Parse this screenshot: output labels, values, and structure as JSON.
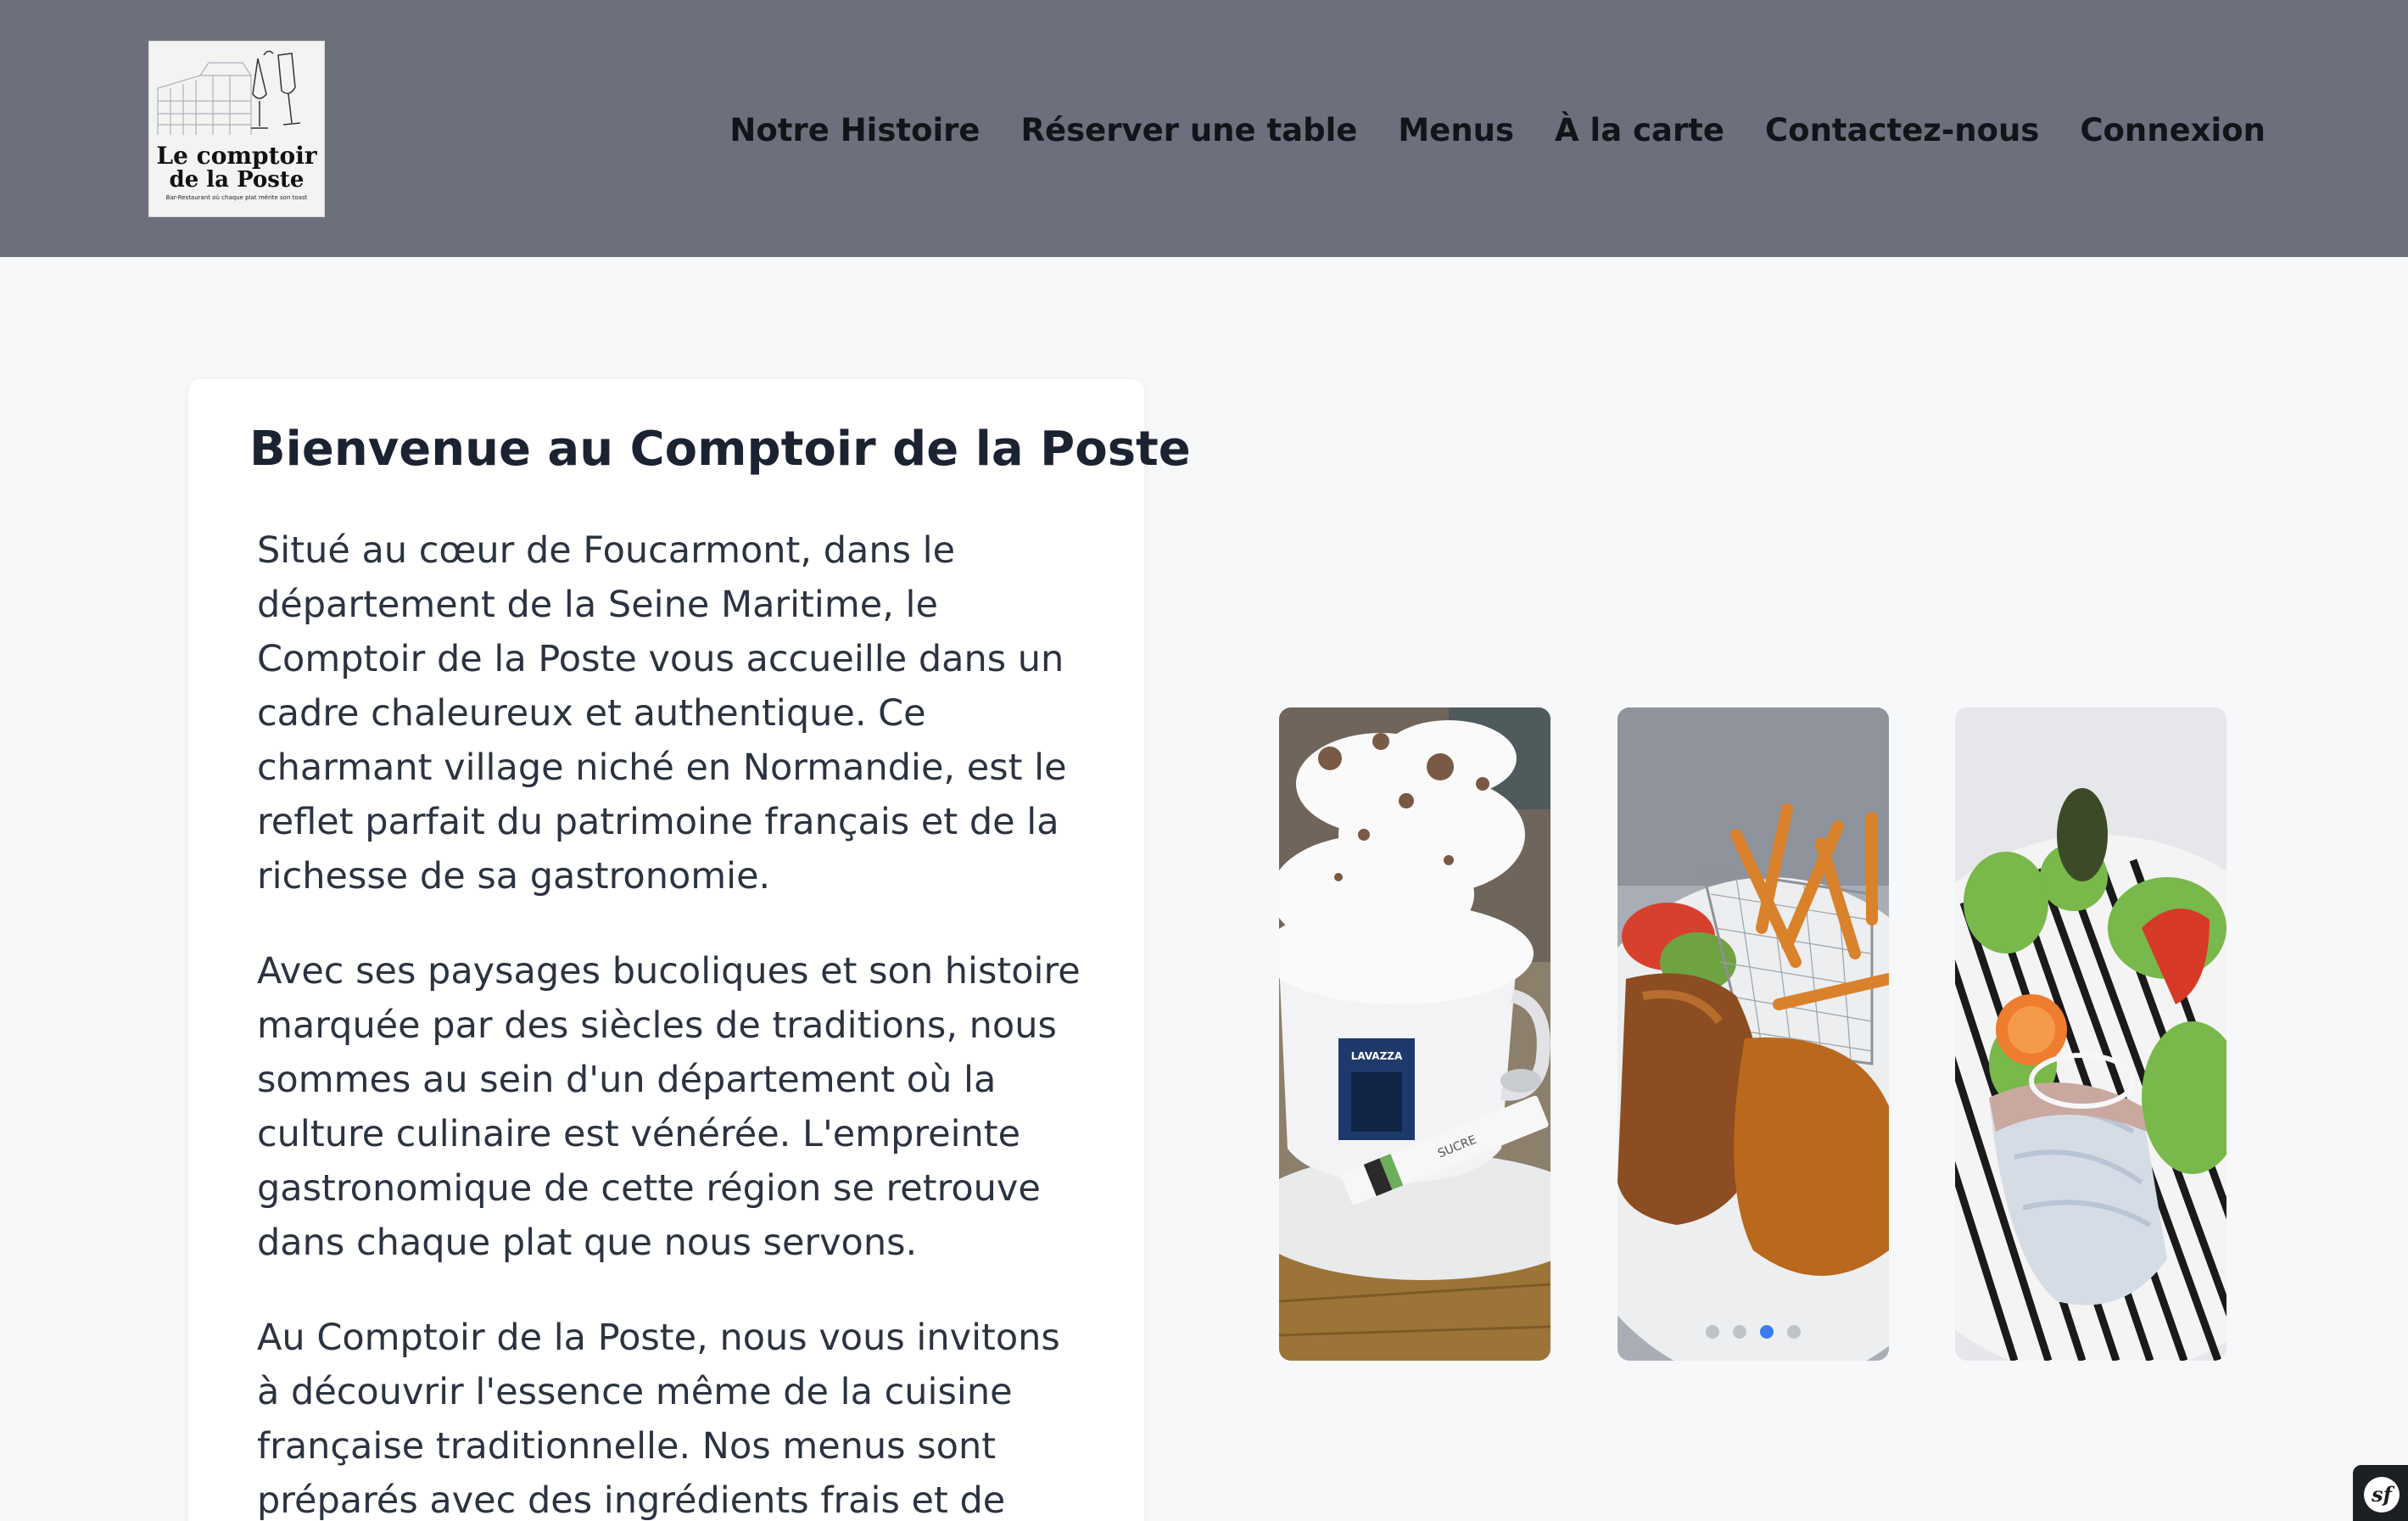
{
  "header": {
    "logo": {
      "line1": "Le comptoir",
      "line2": "de la Poste",
      "tagline": "Bar-Restaurant où chaque plat mérite son toast"
    },
    "nav": [
      {
        "label": "Notre Histoire"
      },
      {
        "label": "Réserver une table"
      },
      {
        "label": "Menus"
      },
      {
        "label": "À la carte"
      },
      {
        "label": "Contactez-nous"
      },
      {
        "label": "Connexion"
      }
    ]
  },
  "intro": {
    "title": "Bienvenue au Comptoir de la Poste",
    "paragraphs": [
      "Situé au cœur de Foucarmont, dans le département de la Seine Maritime, le Comptoir de la Poste vous accueille dans un cadre chaleureux et authentique. Ce charmant village niché en Normandie, est le reflet parfait du patrimoine français et de la richesse de sa gastronomie.",
      "Avec ses paysages bucoliques et son histoire marquée par des siècles de traditions, nous sommes au sein d'un département où la culture culinaire est vénérée. L'empreinte gastronomique de cette région se retrouve dans chaque plat que nous servons.",
      "Au Comptoir de la Poste, nous vous invitons à découvrir l'essence même de la cuisine française traditionnelle. Nos menus sont préparés avec des ingrédients frais et de"
    ]
  },
  "carousel": {
    "slides": [
      {
        "image": "coffee-whipped-cream-photo",
        "cup_brand": "LAVAZZA",
        "sugar_label": "SUCRE"
      },
      {
        "image": "steak-fries-photo"
      },
      {
        "image": "salmon-salad-photo"
      }
    ],
    "dots": 4,
    "active_dot": 3
  },
  "symfony_badge": {
    "icon": "symfony-logo-icon",
    "label": "sf"
  }
}
